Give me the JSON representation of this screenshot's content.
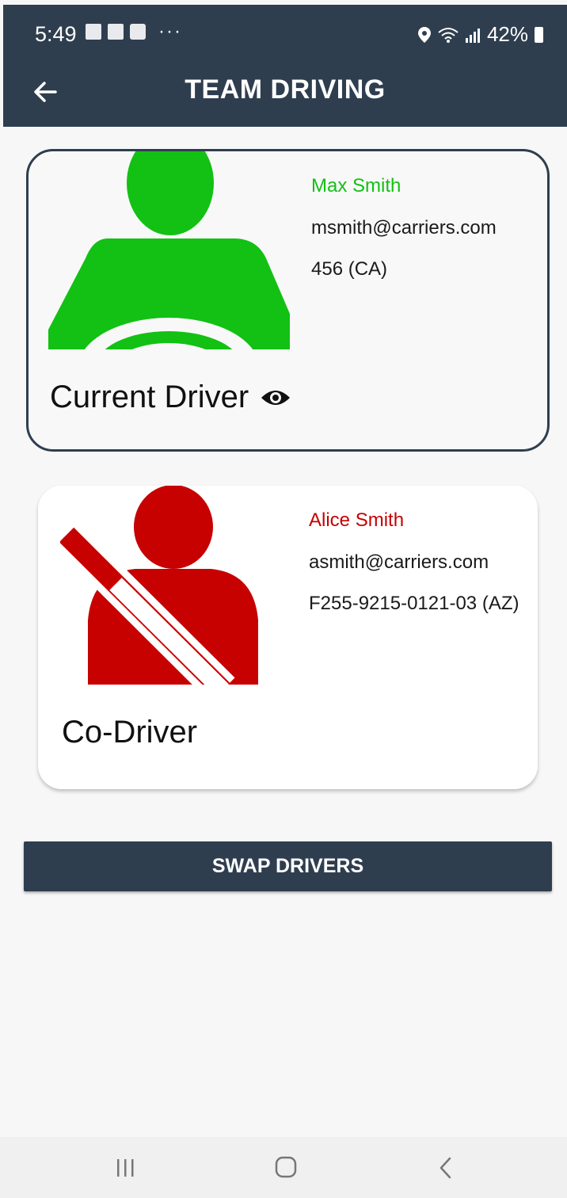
{
  "status_bar": {
    "time": "5:49",
    "dots": "···",
    "battery_text": "42%",
    "icons": [
      "gallery-icon",
      "photo-icon",
      "message-icon",
      "location-icon",
      "wifi-icon",
      "signal-icon",
      "battery-icon"
    ]
  },
  "app_bar": {
    "title": "TEAM DRIVING",
    "back_icon": "arrow-left-icon",
    "color": "#2f3e4f"
  },
  "current_driver": {
    "name": "Max Smith",
    "email": "msmith@carriers.com",
    "license": "456 (CA)",
    "role": "Current Driver",
    "role_icon": "eye-icon",
    "color": "#12c113"
  },
  "co_driver": {
    "name": "Alice Smith",
    "email": "asmith@carriers.com",
    "license": "F255-9215-0121-03 (AZ)",
    "role": "Co-Driver",
    "color": "#c70000"
  },
  "actions": {
    "swap_label": "SWAP DRIVERS"
  },
  "nav_bar": {
    "icons": [
      "recents-icon",
      "home-icon",
      "back-icon"
    ]
  }
}
